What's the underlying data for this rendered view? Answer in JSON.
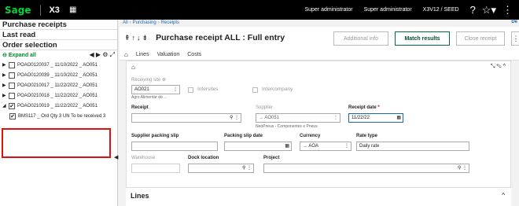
{
  "topbar": {
    "logo": "Sage",
    "product": "X3",
    "user1": "Super administrator",
    "user2": "Super administrator",
    "folder": "X3V12 / SEED"
  },
  "sidebar": {
    "sections": [
      "Purchase receipts",
      "Last read",
      "Order selection"
    ],
    "expand_all": "Expand all",
    "rows": [
      "POAO0120037 _ 11/10/2022 _ AO051",
      "POAO0120039 _ 11/10/2022 _ AO051",
      "POAO0210017 _ 11/22/2022 _ AO051",
      "POAO0210018 _ 11/22/2022 _ AO051",
      "POAO0210019 _ 11/22/2022 _ AO051"
    ],
    "sub_row": "BMS117 _ Ord Qty 3 UN To be received 3"
  },
  "breadcrumb": {
    "all": "All",
    "purchasing": "Purchasing",
    "receipts": "Receipts",
    "de": "De"
  },
  "header": {
    "title": "Purchase receipt ALL : Full entry",
    "additional_info": "Additional info",
    "match_results": "Match results",
    "close_receipt": "Close receipt"
  },
  "tabs": [
    "Lines",
    "Valuation",
    "Costs"
  ],
  "form": {
    "receiving_site_label": "Receiving site",
    "receiving_site_value": "AO021",
    "receiving_site_desc": "Agro Alimentar do ...",
    "intersites": "Intersites",
    "intercompany": "Intercompany",
    "receipt_label": "Receipt",
    "supplier_label": "Supplier",
    "supplier_value": "AO051",
    "supplier_desc": "NeoPneus - Componentes e Pneus",
    "receipt_date_label": "Receipt date",
    "receipt_date_value": "11/22/22",
    "packing_slip_label": "Supplier packing slip",
    "packing_slip_date_label": "Packing slip date",
    "currency_label": "Currency",
    "currency_value": "AOA",
    "rate_type_label": "Rate type",
    "rate_type_value": "Daily rate",
    "warehouse_label": "Warehouse",
    "dock_label": "Dock location",
    "project_label": "Project"
  },
  "lines_section": "Lines"
}
